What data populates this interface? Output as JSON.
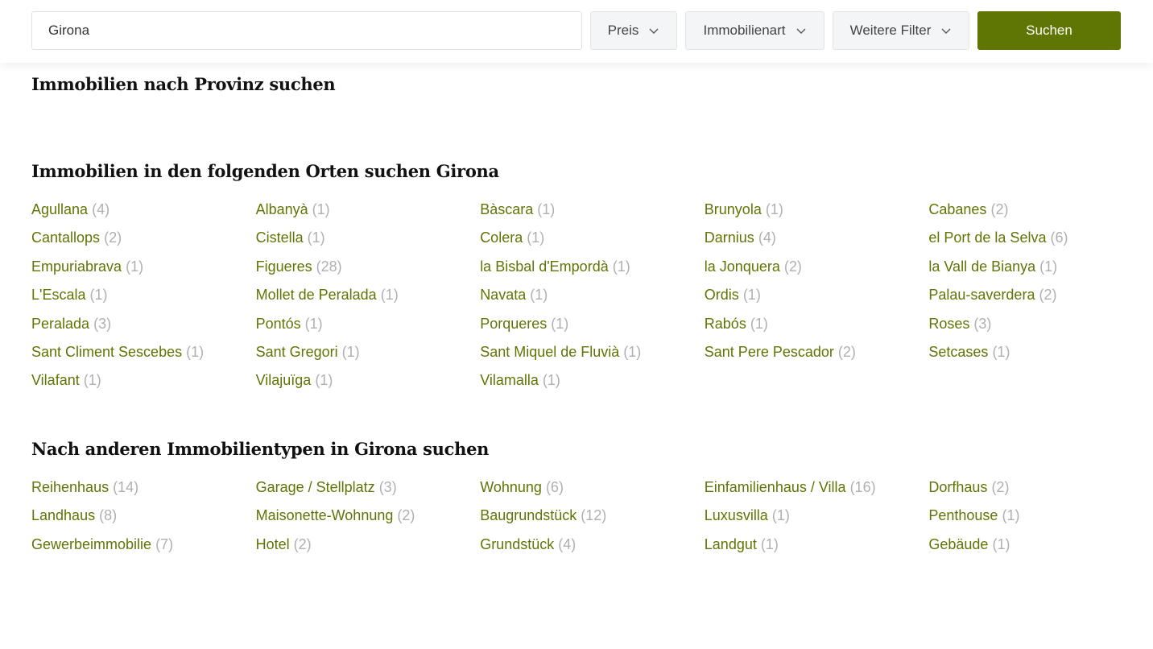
{
  "search": {
    "value": "Girona",
    "preis_label": "Preis",
    "immobilienart_label": "Immobilienart",
    "weitere_filter_label": "Weitere Filter",
    "suchen_label": "Suchen"
  },
  "colors": {
    "accent": "#5f7504",
    "count_gray": "#aeb0b3"
  },
  "sections": {
    "provinz_title": "Immobilien nach Provinz suchen",
    "orte_title": "Immobilien in den folgenden Orten suchen Girona",
    "typen_title": "Nach anderen Immobilientypen in Girona suchen"
  },
  "orte": [
    {
      "name": "Agullana",
      "count": "(4)"
    },
    {
      "name": "Albanyà",
      "count": "(1)"
    },
    {
      "name": "Bàscara",
      "count": "(1)"
    },
    {
      "name": "Brunyola",
      "count": "(1)"
    },
    {
      "name": "Cabanes",
      "count": "(2)"
    },
    {
      "name": "Cantallops",
      "count": "(2)"
    },
    {
      "name": "Cistella",
      "count": "(1)"
    },
    {
      "name": "Colera",
      "count": "(1)"
    },
    {
      "name": "Darnius",
      "count": "(4)"
    },
    {
      "name": "el Port de la Selva",
      "count": "(6)"
    },
    {
      "name": "Empuriabrava",
      "count": "(1)"
    },
    {
      "name": "Figueres",
      "count": "(28)"
    },
    {
      "name": "la Bisbal d'Empordà",
      "count": "(1)"
    },
    {
      "name": "la Jonquera",
      "count": "(2)"
    },
    {
      "name": "la Vall de Bianya",
      "count": "(1)"
    },
    {
      "name": "L'Escala",
      "count": "(1)"
    },
    {
      "name": "Mollet de Peralada",
      "count": "(1)"
    },
    {
      "name": "Navata",
      "count": "(1)"
    },
    {
      "name": "Ordis",
      "count": "(1)"
    },
    {
      "name": "Palau-saverdera",
      "count": "(2)"
    },
    {
      "name": "Peralada",
      "count": "(3)"
    },
    {
      "name": "Pontós",
      "count": "(1)"
    },
    {
      "name": "Porqueres",
      "count": "(1)"
    },
    {
      "name": "Rabós",
      "count": "(1)"
    },
    {
      "name": "Roses",
      "count": "(3)"
    },
    {
      "name": "Sant Climent Sescebes",
      "count": "(1)"
    },
    {
      "name": "Sant Gregori",
      "count": "(1)"
    },
    {
      "name": "Sant Miquel de Fluvià",
      "count": "(1)"
    },
    {
      "name": "Sant Pere Pescador",
      "count": "(2)"
    },
    {
      "name": "Setcases",
      "count": "(1)"
    },
    {
      "name": "Vilafant",
      "count": "(1)"
    },
    {
      "name": "Vilajuïga",
      "count": "(1)"
    },
    {
      "name": "Vilamalla",
      "count": "(1)"
    }
  ],
  "typen": [
    {
      "name": "Reihenhaus",
      "count": "(14)"
    },
    {
      "name": "Garage / Stellplatz",
      "count": "(3)"
    },
    {
      "name": "Wohnung",
      "count": "(6)"
    },
    {
      "name": "Einfamilienhaus / Villa",
      "count": "(16)"
    },
    {
      "name": "Dorfhaus",
      "count": "(2)"
    },
    {
      "name": "Landhaus",
      "count": "(8)"
    },
    {
      "name": "Maisonette-Wohnung",
      "count": "(2)"
    },
    {
      "name": "Baugrundstück",
      "count": "(12)"
    },
    {
      "name": "Luxusvilla",
      "count": "(1)"
    },
    {
      "name": "Penthouse",
      "count": "(1)"
    },
    {
      "name": "Gewerbeimmobilie",
      "count": "(7)"
    },
    {
      "name": "Hotel",
      "count": "(2)"
    },
    {
      "name": "Grundstück",
      "count": "(4)"
    },
    {
      "name": "Landgut",
      "count": "(1)"
    },
    {
      "name": "Gebäude",
      "count": "(1)"
    }
  ]
}
